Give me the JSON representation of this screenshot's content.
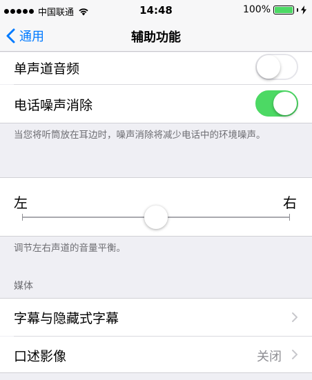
{
  "status_bar": {
    "carrier": "中国联通",
    "time": "14:48",
    "battery_percent": "100%",
    "battery_level": 1.0
  },
  "nav": {
    "back_label": "通用",
    "title": "辅助功能"
  },
  "rows": {
    "mono_audio": {
      "label": "单声道音频",
      "on": false
    },
    "noise_cancel": {
      "label": "电话噪声消除",
      "on": true
    },
    "noise_footer": "当您将听筒放在耳边时，噪声消除将减少电话中的环境噪声。"
  },
  "balance": {
    "left_label": "左",
    "right_label": "右",
    "value": 0.5,
    "footer": "调节左右声道的音量平衡。"
  },
  "media": {
    "header": "媒体",
    "subtitles_label": "字幕与隐藏式字幕",
    "audio_desc_label": "口述影像",
    "audio_desc_value": "关闭"
  },
  "colors": {
    "accent": "#007aff",
    "toggle_on": "#4cd964"
  }
}
